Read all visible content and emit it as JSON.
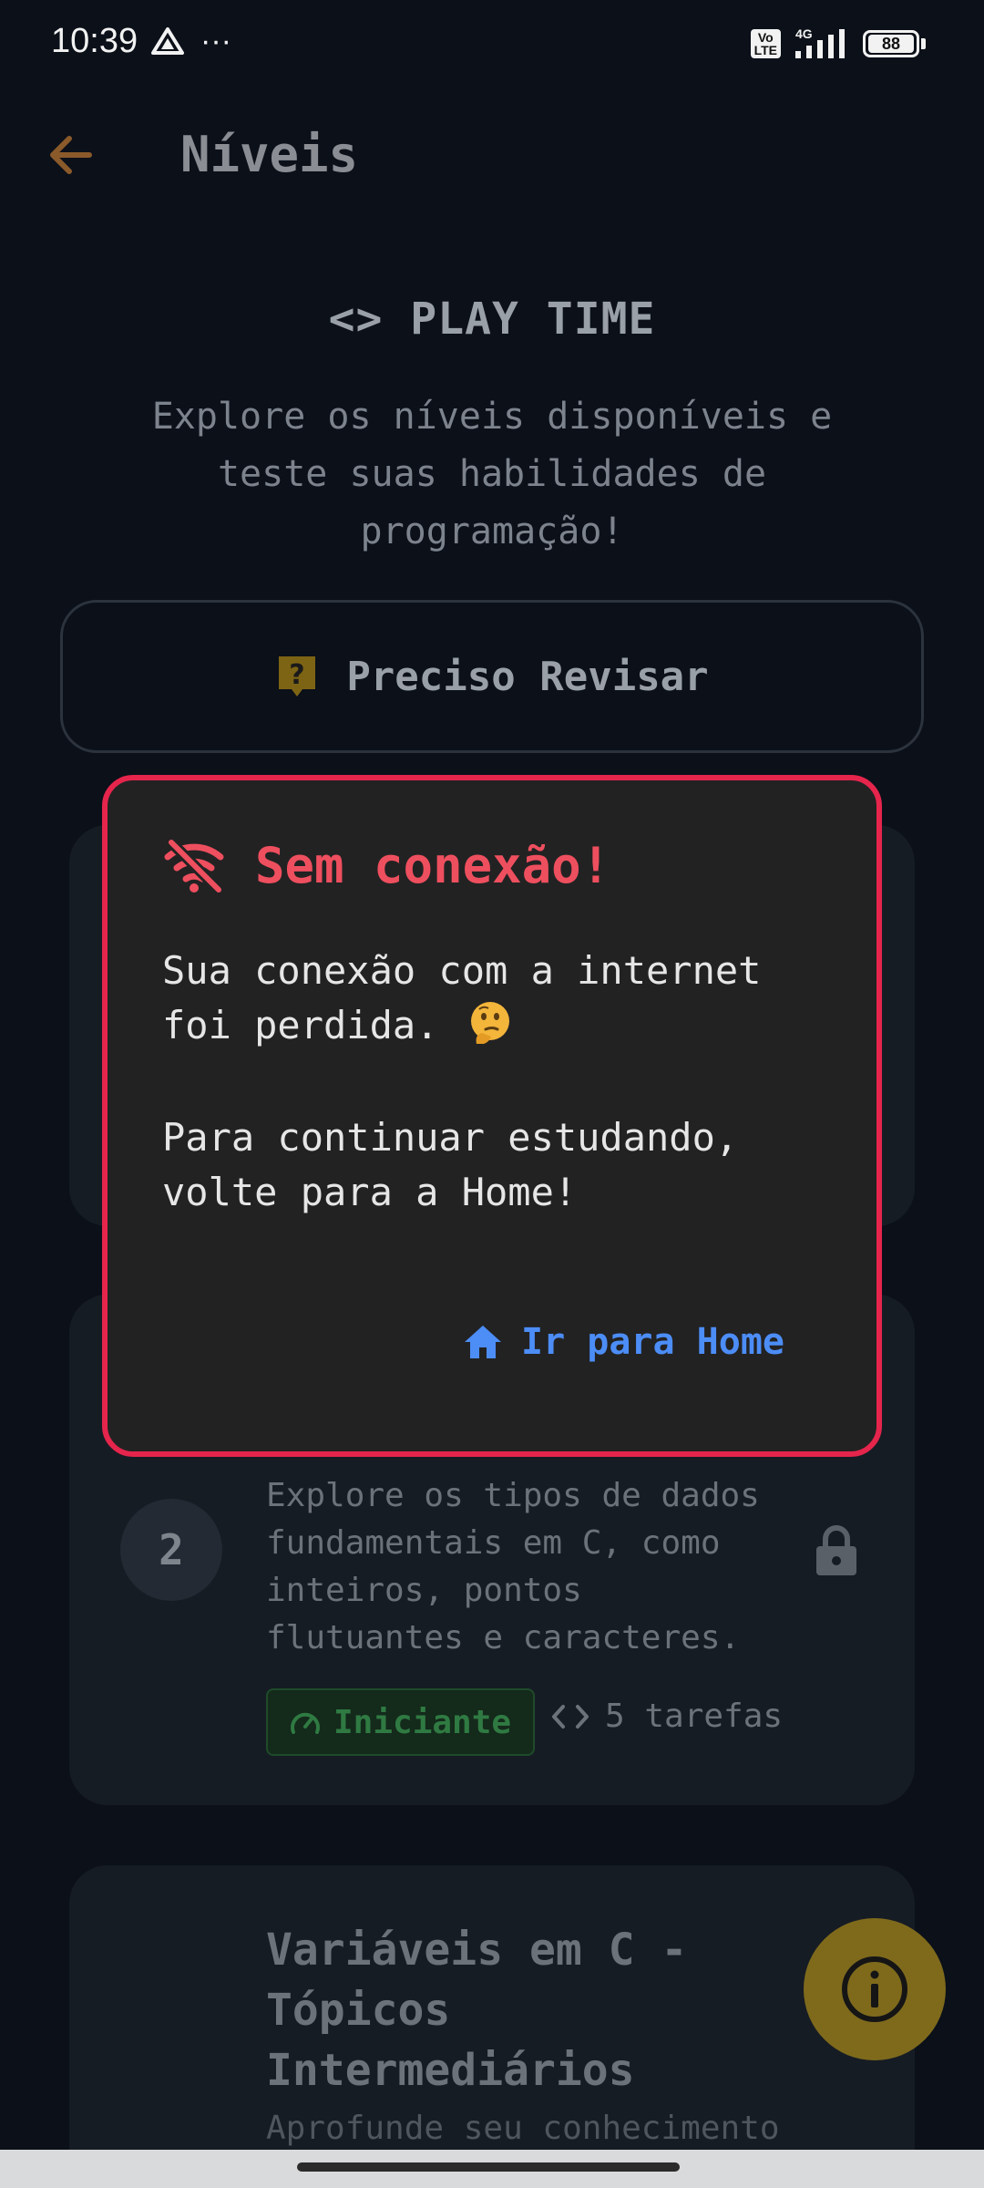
{
  "status_bar": {
    "time": "10:39",
    "dots": "···",
    "volte": "Vo\nLTE",
    "network": "4G",
    "battery": "88"
  },
  "app_bar": {
    "title": "Níveis",
    "back_icon": "arrow-back-icon"
  },
  "header": {
    "heading": "<> PLAY TIME",
    "intro_line1": "Explore os níveis disponíveis e",
    "intro_line2": "teste suas habilidades de",
    "intro_line3": "programação!"
  },
  "review_button": {
    "label": "Preciso Revisar",
    "icon": "help-question-icon",
    "icon_color": "#b8921a"
  },
  "levels": [
    {
      "number": "2",
      "description_lines": [
        "Explore os tipos de dados",
        "fundamentais em C, como",
        "inteiros, pontos",
        "flutuantes e caracteres."
      ],
      "badge": "Iniciante",
      "tasks": "5 tarefas",
      "locked": true
    },
    {
      "title_lines": [
        "Variáveis em C -",
        "Tópicos",
        "Intermediários"
      ],
      "description": "Aprofunde seu conhecimento"
    }
  ],
  "dialog": {
    "title": "Sem conexão!",
    "icon": "wifi-off-icon",
    "line1": "Sua conexão com a internet",
    "line2": "foi perdida.",
    "emoji": "thinking-face-icon",
    "line3": "Para continuar estudando,",
    "line4": "volte para a Home!",
    "action_label": "Ir para Home",
    "action_icon": "home-icon",
    "accent": "#e5254c",
    "title_color": "#ee4f5e",
    "action_color": "#4c8df6"
  },
  "fab": {
    "icon": "info-icon",
    "color": "#7f6a1c"
  }
}
